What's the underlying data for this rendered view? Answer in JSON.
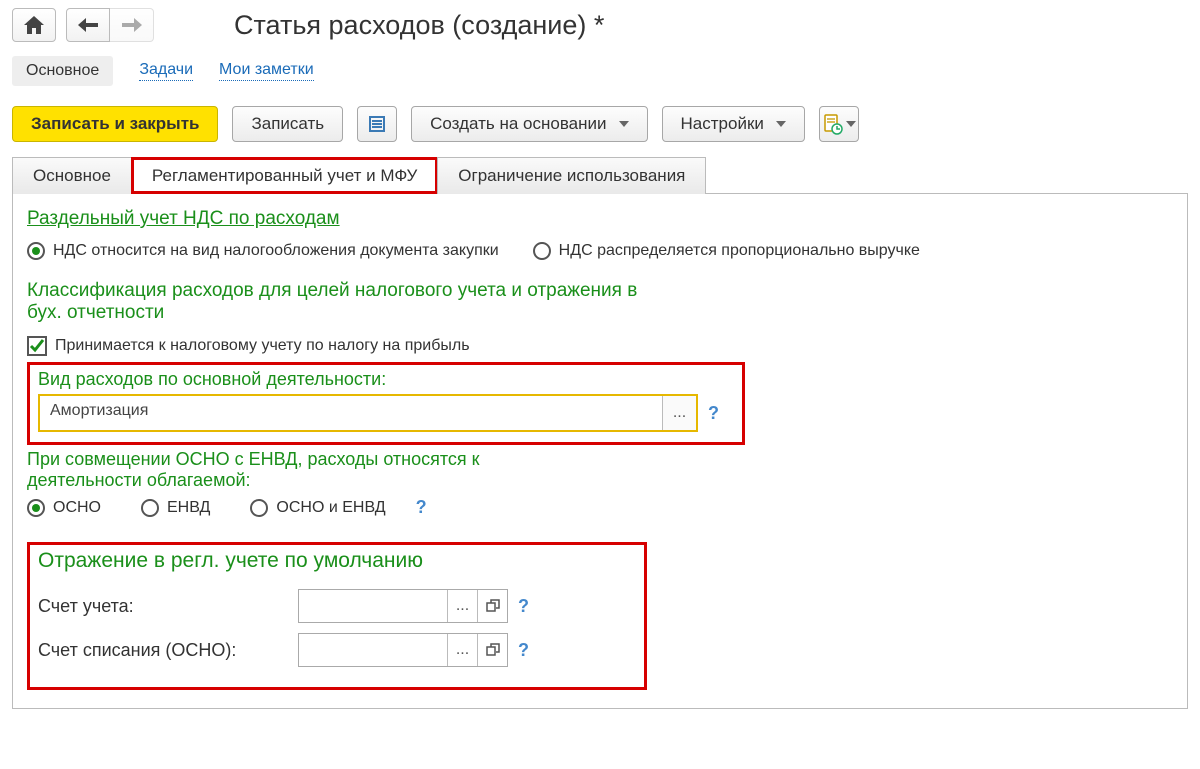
{
  "header": {
    "title": "Статья расходов (создание) *"
  },
  "sections": {
    "current": "Основное",
    "tasks": "Задачи",
    "notes": "Мои заметки"
  },
  "toolbar": {
    "save_close": "Записать и закрыть",
    "save": "Записать",
    "create_based": "Создать на основании",
    "settings": "Настройки"
  },
  "tabs": {
    "main": "Основное",
    "reg": "Регламентированный учет и МФУ",
    "restrict": "Ограничение использования"
  },
  "vat": {
    "title": "Раздельный учет НДС по расходам",
    "opt1": "НДС относится на вид налогообложения документа закупки",
    "opt2": "НДС распределяется пропорционально выручке"
  },
  "classification": {
    "title": "Классификация расходов для целей налогового учета и отражения в бух. отчетности",
    "checkbox": "Принимается к налоговому учету по налогу на прибыль"
  },
  "expense_kind": {
    "label": "Вид расходов по основной деятельности:",
    "value": "Амортизация"
  },
  "combine": {
    "label": "При совмещении ОСНО с ЕНВД, расходы относятся к деятельности облагаемой:",
    "opt1": "ОСНО",
    "opt2": "ЕНВД",
    "opt3": "ОСНО и ЕНВД"
  },
  "reg_defaults": {
    "title": "Отражение в регл. учете по умолчанию",
    "account_label": "Счет учета:",
    "writeoff_label": "Счет списания (ОСНО):"
  },
  "glyphs": {
    "ellipsis": "...",
    "help": "?"
  }
}
